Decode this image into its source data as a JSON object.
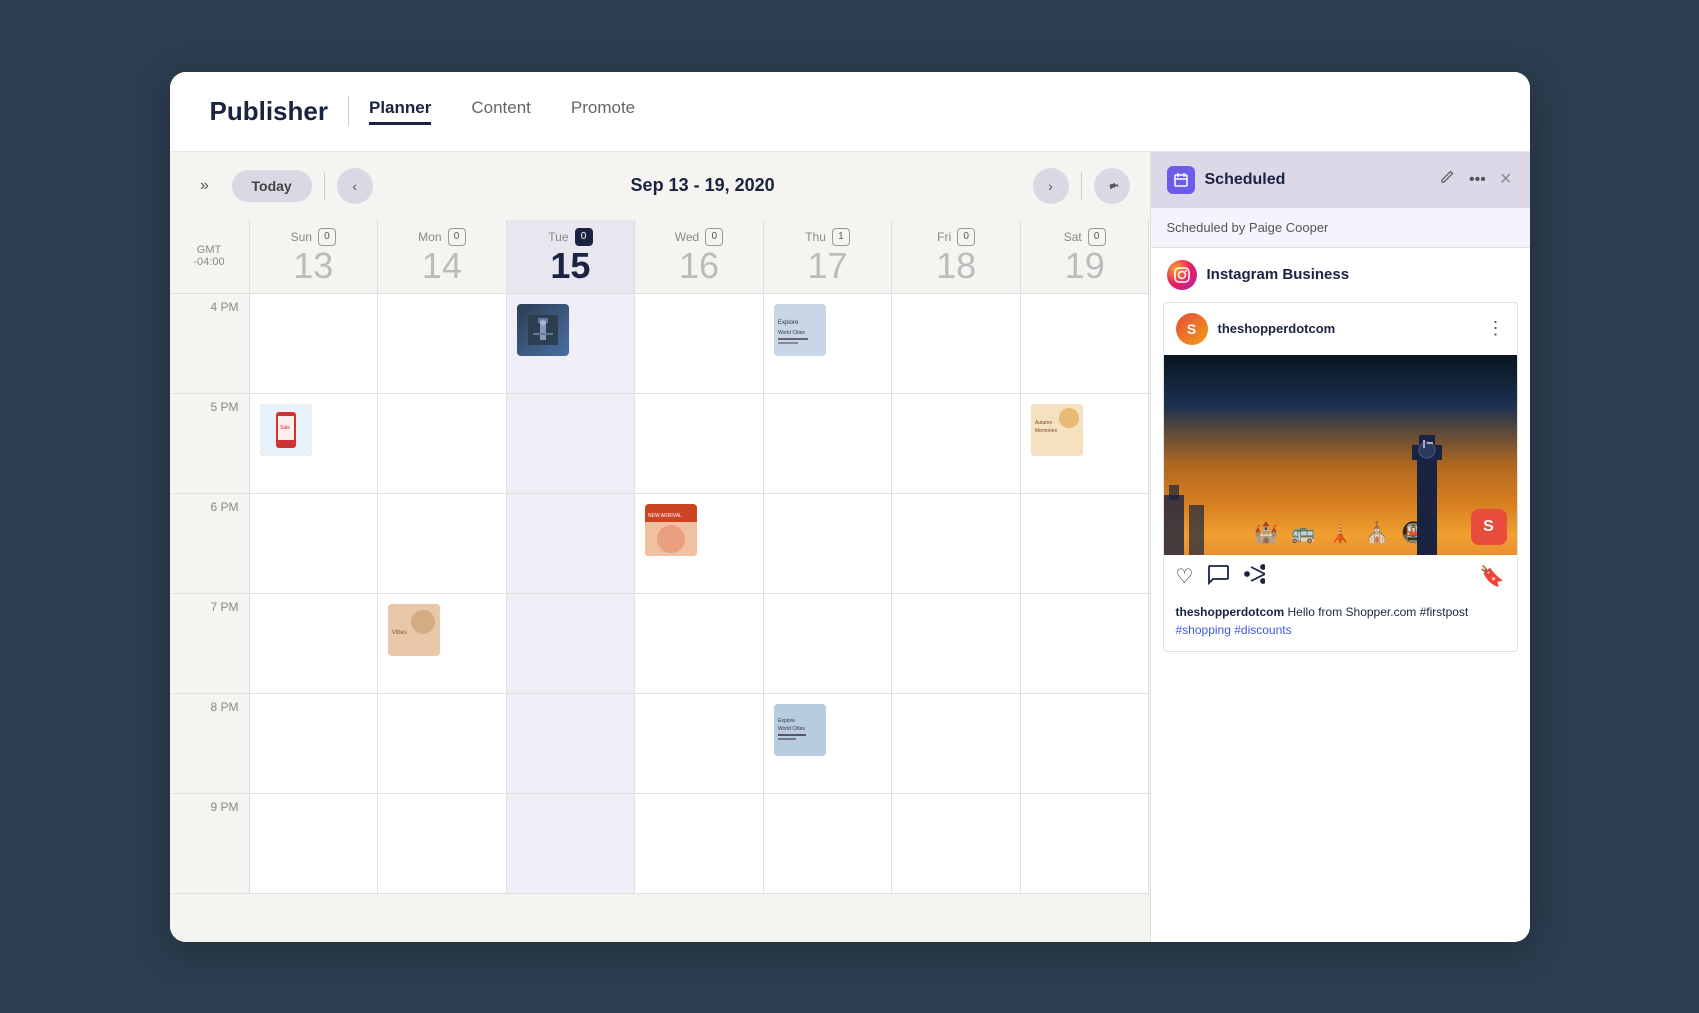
{
  "header": {
    "title": "Publisher",
    "nav_tabs": [
      {
        "id": "planner",
        "label": "Planner",
        "active": true
      },
      {
        "id": "content",
        "label": "Content",
        "active": false
      },
      {
        "id": "promote",
        "label": "Promote",
        "active": false
      }
    ]
  },
  "toolbar": {
    "today_label": "Today",
    "date_range": "Sep 13 - 19, 2020",
    "collapse_label": "»",
    "prev_label": "‹",
    "next_label": "›"
  },
  "calendar": {
    "gmt": "GMT",
    "offset": "-04:00",
    "days": [
      {
        "name": "Sun",
        "number": "13",
        "count": "0",
        "today": false
      },
      {
        "name": "Mon",
        "number": "14",
        "count": "0",
        "today": false
      },
      {
        "name": "Tue",
        "number": "15",
        "count": "0",
        "today": true
      },
      {
        "name": "Wed",
        "number": "16",
        "count": "0",
        "today": false
      },
      {
        "name": "Thu",
        "number": "17",
        "count": "1",
        "today": false
      },
      {
        "name": "Fri",
        "number": "18",
        "count": "0",
        "today": false
      },
      {
        "name": "Sat",
        "number": "19",
        "count": "0",
        "today": false
      }
    ],
    "time_slots": [
      {
        "label": "4 PM",
        "posts": [
          {
            "day": 2,
            "type": "london"
          },
          {
            "day": 4,
            "type": "explore"
          }
        ]
      },
      {
        "label": "5 PM",
        "posts": [
          {
            "day": 0,
            "type": "phone"
          },
          {
            "day": 6,
            "type": "memories"
          }
        ]
      },
      {
        "label": "6 PM",
        "posts": [
          {
            "day": 3,
            "type": "newarrival"
          }
        ]
      },
      {
        "label": "7 PM",
        "posts": [
          {
            "day": 1,
            "type": "vibes"
          }
        ]
      },
      {
        "label": "8 PM",
        "posts": [
          {
            "day": 4,
            "type": "explore2"
          }
        ]
      },
      {
        "label": "9 PM",
        "posts": []
      }
    ]
  },
  "side_panel": {
    "title": "Scheduled",
    "subtitle": "Scheduled by Paige Cooper",
    "account_name": "Instagram Business",
    "ig_username": "theshopperdotcom",
    "ig_user_initial": "S",
    "post_caption": " Hello from Shopper.com #firstpost",
    "hashtags": "#shopping #discounts",
    "more_options_label": "⋮",
    "edit_label": "✎",
    "actions_label": "•••",
    "close_label": "×"
  }
}
